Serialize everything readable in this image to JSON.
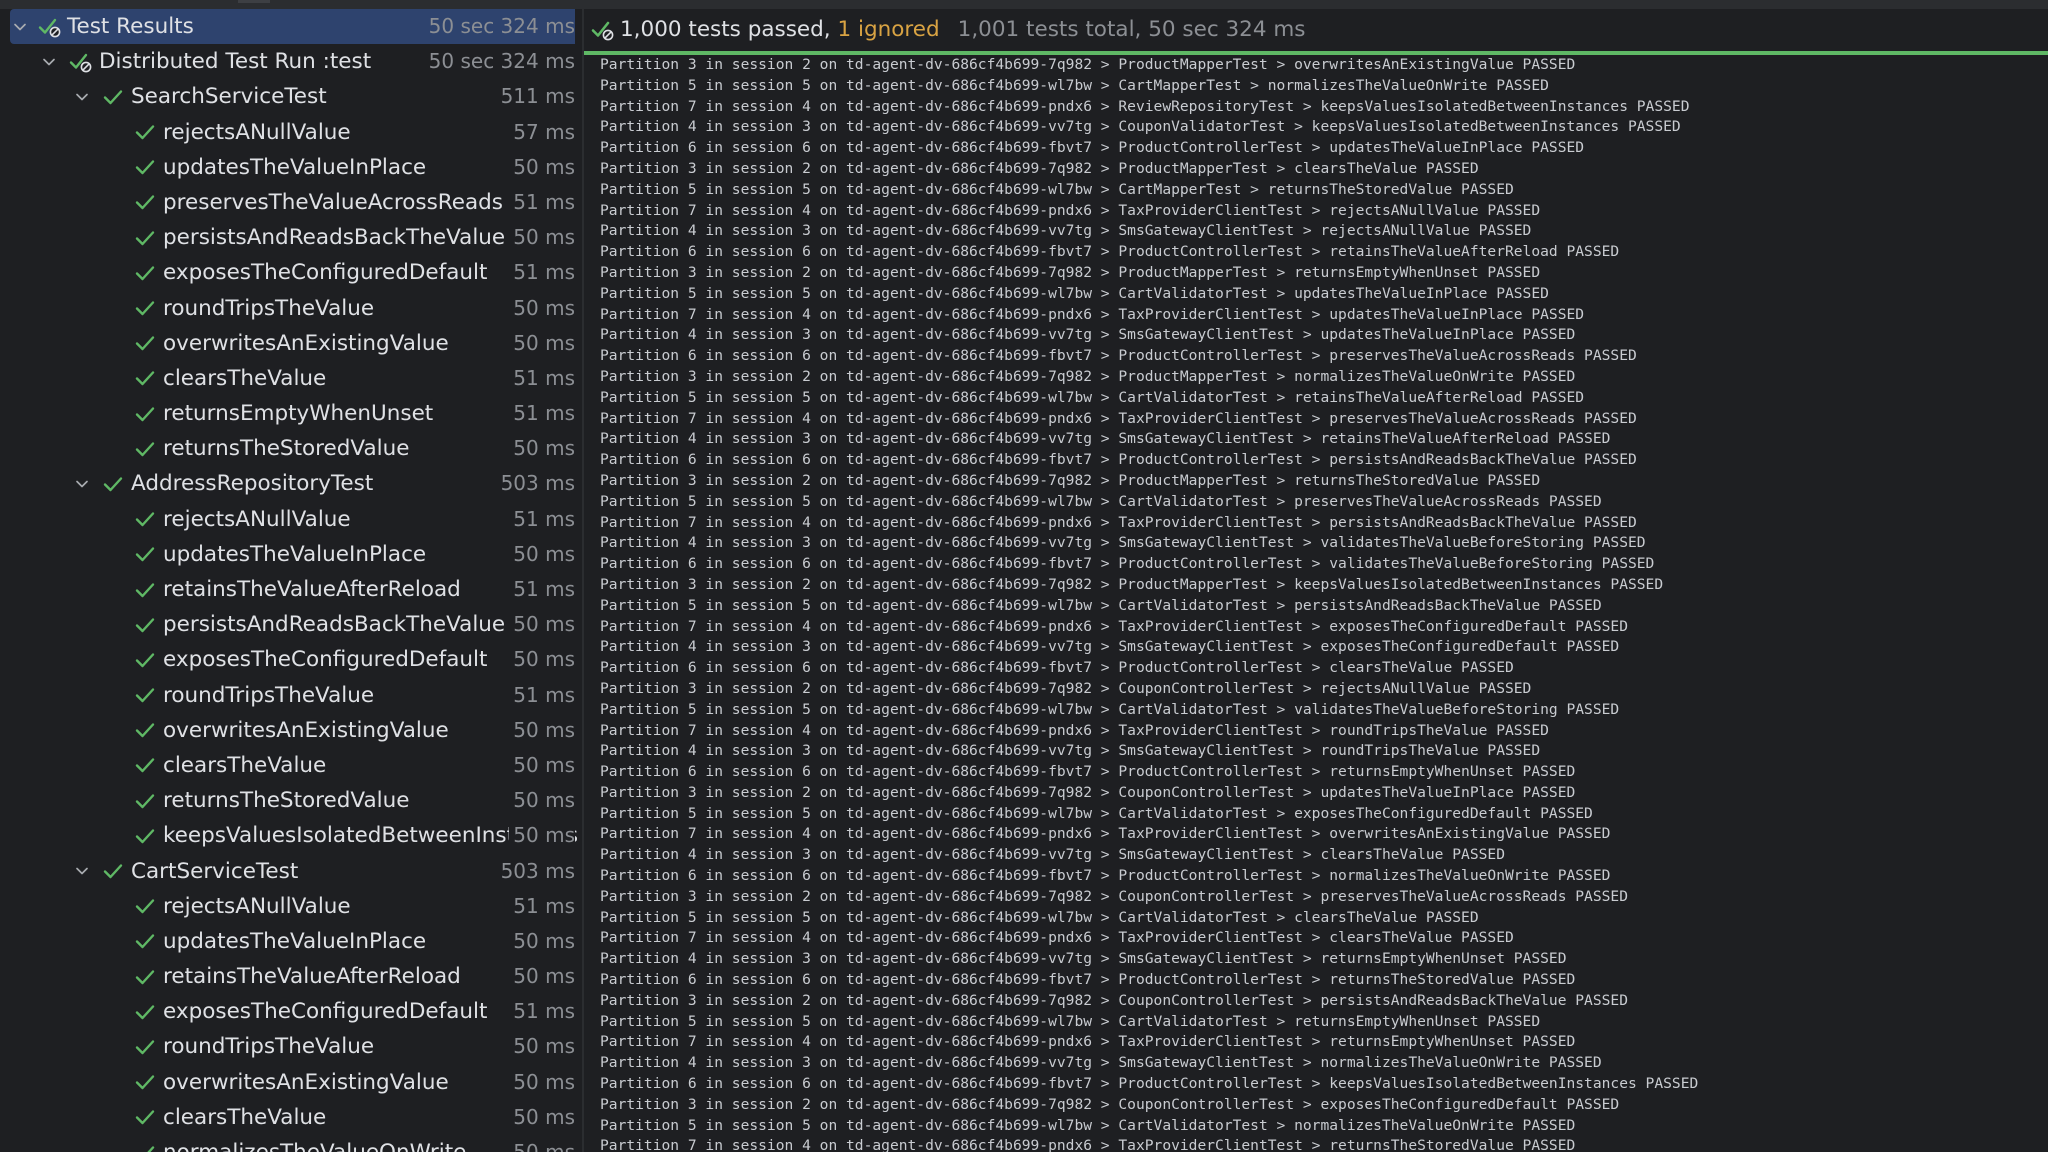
{
  "tree": {
    "rows": [
      {
        "depth": 0,
        "label": "Test Results",
        "duration": "50 sec 324 ms",
        "expanded": true,
        "status": "passed-ignored",
        "selected": true
      },
      {
        "depth": 1,
        "label": "Distributed Test Run :test",
        "duration": "50 sec 324 ms",
        "expanded": true,
        "status": "passed-ignored"
      },
      {
        "depth": 2,
        "label": "SearchServiceTest",
        "duration": "511 ms",
        "expanded": true,
        "status": "passed"
      },
      {
        "depth": 3,
        "label": "rejectsANullValue",
        "duration": "57 ms",
        "status": "passed"
      },
      {
        "depth": 3,
        "label": "updatesTheValueInPlace",
        "duration": "50 ms",
        "status": "passed"
      },
      {
        "depth": 3,
        "label": "preservesTheValueAcrossReads",
        "duration": "51 ms",
        "status": "passed"
      },
      {
        "depth": 3,
        "label": "persistsAndReadsBackTheValue",
        "duration": "50 ms",
        "status": "passed"
      },
      {
        "depth": 3,
        "label": "exposesTheConfiguredDefault",
        "duration": "51 ms",
        "status": "passed"
      },
      {
        "depth": 3,
        "label": "roundTripsTheValue",
        "duration": "50 ms",
        "status": "passed"
      },
      {
        "depth": 3,
        "label": "overwritesAnExistingValue",
        "duration": "50 ms",
        "status": "passed"
      },
      {
        "depth": 3,
        "label": "clearsTheValue",
        "duration": "51 ms",
        "status": "passed"
      },
      {
        "depth": 3,
        "label": "returnsEmptyWhenUnset",
        "duration": "51 ms",
        "status": "passed"
      },
      {
        "depth": 3,
        "label": "returnsTheStoredValue",
        "duration": "50 ms",
        "status": "passed"
      },
      {
        "depth": 2,
        "label": "AddressRepositoryTest",
        "duration": "503 ms",
        "expanded": true,
        "status": "passed"
      },
      {
        "depth": 3,
        "label": "rejectsANullValue",
        "duration": "51 ms",
        "status": "passed"
      },
      {
        "depth": 3,
        "label": "updatesTheValueInPlace",
        "duration": "50 ms",
        "status": "passed"
      },
      {
        "depth": 3,
        "label": "retainsTheValueAfterReload",
        "duration": "51 ms",
        "status": "passed"
      },
      {
        "depth": 3,
        "label": "persistsAndReadsBackTheValue",
        "duration": "50 ms",
        "status": "passed"
      },
      {
        "depth": 3,
        "label": "exposesTheConfiguredDefault",
        "duration": "50 ms",
        "status": "passed"
      },
      {
        "depth": 3,
        "label": "roundTripsTheValue",
        "duration": "51 ms",
        "status": "passed"
      },
      {
        "depth": 3,
        "label": "overwritesAnExistingValue",
        "duration": "50 ms",
        "status": "passed"
      },
      {
        "depth": 3,
        "label": "clearsTheValue",
        "duration": "50 ms",
        "status": "passed"
      },
      {
        "depth": 3,
        "label": "returnsTheStoredValue",
        "duration": "50 ms",
        "status": "passed"
      },
      {
        "depth": 3,
        "label": "keepsValuesIsolatedBetweenInstances",
        "duration": "50 ms",
        "status": "passed"
      },
      {
        "depth": 2,
        "label": "CartServiceTest",
        "duration": "503 ms",
        "expanded": true,
        "status": "passed"
      },
      {
        "depth": 3,
        "label": "rejectsANullValue",
        "duration": "51 ms",
        "status": "passed"
      },
      {
        "depth": 3,
        "label": "updatesTheValueInPlace",
        "duration": "50 ms",
        "status": "passed"
      },
      {
        "depth": 3,
        "label": "retainsTheValueAfterReload",
        "duration": "50 ms",
        "status": "passed"
      },
      {
        "depth": 3,
        "label": "exposesTheConfiguredDefault",
        "duration": "51 ms",
        "status": "passed"
      },
      {
        "depth": 3,
        "label": "roundTripsTheValue",
        "duration": "50 ms",
        "status": "passed"
      },
      {
        "depth": 3,
        "label": "overwritesAnExistingValue",
        "duration": "50 ms",
        "status": "passed"
      },
      {
        "depth": 3,
        "label": "clearsTheValue",
        "duration": "50 ms",
        "status": "passed"
      },
      {
        "depth": 3,
        "label": "normalizesTheValueOnWrite",
        "duration": "50 ms",
        "status": "passed"
      }
    ]
  },
  "summary": {
    "passed": "1,000 tests passed,",
    "ignored": "1 ignored",
    "total": "1,001 tests total, 50 sec 324 ms"
  },
  "console": {
    "lines": [
      "Partition 3 in session 2 on td-agent-dv-686cf4b699-7q982 > ProductMapperTest > overwritesAnExistingValue PASSED",
      "Partition 5 in session 5 on td-agent-dv-686cf4b699-wl7bw > CartMapperTest > normalizesTheValueOnWrite PASSED",
      "Partition 7 in session 4 on td-agent-dv-686cf4b699-pndx6 > ReviewRepositoryTest > keepsValuesIsolatedBetweenInstances PASSED",
      "Partition 4 in session 3 on td-agent-dv-686cf4b699-vv7tg > CouponValidatorTest > keepsValuesIsolatedBetweenInstances PASSED",
      "Partition 6 in session 6 on td-agent-dv-686cf4b699-fbvt7 > ProductControllerTest > updatesTheValueInPlace PASSED",
      "Partition 3 in session 2 on td-agent-dv-686cf4b699-7q982 > ProductMapperTest > clearsTheValue PASSED",
      "Partition 5 in session 5 on td-agent-dv-686cf4b699-wl7bw > CartMapperTest > returnsTheStoredValue PASSED",
      "Partition 7 in session 4 on td-agent-dv-686cf4b699-pndx6 > TaxProviderClientTest > rejectsANullValue PASSED",
      "Partition 4 in session 3 on td-agent-dv-686cf4b699-vv7tg > SmsGatewayClientTest > rejectsANullValue PASSED",
      "Partition 6 in session 6 on td-agent-dv-686cf4b699-fbvt7 > ProductControllerTest > retainsTheValueAfterReload PASSED",
      "Partition 3 in session 2 on td-agent-dv-686cf4b699-7q982 > ProductMapperTest > returnsEmptyWhenUnset PASSED",
      "Partition 5 in session 5 on td-agent-dv-686cf4b699-wl7bw > CartValidatorTest > updatesTheValueInPlace PASSED",
      "Partition 7 in session 4 on td-agent-dv-686cf4b699-pndx6 > TaxProviderClientTest > updatesTheValueInPlace PASSED",
      "Partition 4 in session 3 on td-agent-dv-686cf4b699-vv7tg > SmsGatewayClientTest > updatesTheValueInPlace PASSED",
      "Partition 6 in session 6 on td-agent-dv-686cf4b699-fbvt7 > ProductControllerTest > preservesTheValueAcrossReads PASSED",
      "Partition 3 in session 2 on td-agent-dv-686cf4b699-7q982 > ProductMapperTest > normalizesTheValueOnWrite PASSED",
      "Partition 5 in session 5 on td-agent-dv-686cf4b699-wl7bw > CartValidatorTest > retainsTheValueAfterReload PASSED",
      "Partition 7 in session 4 on td-agent-dv-686cf4b699-pndx6 > TaxProviderClientTest > preservesTheValueAcrossReads PASSED",
      "Partition 4 in session 3 on td-agent-dv-686cf4b699-vv7tg > SmsGatewayClientTest > retainsTheValueAfterReload PASSED",
      "Partition 6 in session 6 on td-agent-dv-686cf4b699-fbvt7 > ProductControllerTest > persistsAndReadsBackTheValue PASSED",
      "Partition 3 in session 2 on td-agent-dv-686cf4b699-7q982 > ProductMapperTest > returnsTheStoredValue PASSED",
      "Partition 5 in session 5 on td-agent-dv-686cf4b699-wl7bw > CartValidatorTest > preservesTheValueAcrossReads PASSED",
      "Partition 7 in session 4 on td-agent-dv-686cf4b699-pndx6 > TaxProviderClientTest > persistsAndReadsBackTheValue PASSED",
      "Partition 4 in session 3 on td-agent-dv-686cf4b699-vv7tg > SmsGatewayClientTest > validatesTheValueBeforeStoring PASSED",
      "Partition 6 in session 6 on td-agent-dv-686cf4b699-fbvt7 > ProductControllerTest > validatesTheValueBeforeStoring PASSED",
      "Partition 3 in session 2 on td-agent-dv-686cf4b699-7q982 > ProductMapperTest > keepsValuesIsolatedBetweenInstances PASSED",
      "Partition 5 in session 5 on td-agent-dv-686cf4b699-wl7bw > CartValidatorTest > persistsAndReadsBackTheValue PASSED",
      "Partition 7 in session 4 on td-agent-dv-686cf4b699-pndx6 > TaxProviderClientTest > exposesTheConfiguredDefault PASSED",
      "Partition 4 in session 3 on td-agent-dv-686cf4b699-vv7tg > SmsGatewayClientTest > exposesTheConfiguredDefault PASSED",
      "Partition 6 in session 6 on td-agent-dv-686cf4b699-fbvt7 > ProductControllerTest > clearsTheValue PASSED",
      "Partition 3 in session 2 on td-agent-dv-686cf4b699-7q982 > CouponControllerTest > rejectsANullValue PASSED",
      "Partition 5 in session 5 on td-agent-dv-686cf4b699-wl7bw > CartValidatorTest > validatesTheValueBeforeStoring PASSED",
      "Partition 7 in session 4 on td-agent-dv-686cf4b699-pndx6 > TaxProviderClientTest > roundTripsTheValue PASSED",
      "Partition 4 in session 3 on td-agent-dv-686cf4b699-vv7tg > SmsGatewayClientTest > roundTripsTheValue PASSED",
      "Partition 6 in session 6 on td-agent-dv-686cf4b699-fbvt7 > ProductControllerTest > returnsEmptyWhenUnset PASSED",
      "Partition 3 in session 2 on td-agent-dv-686cf4b699-7q982 > CouponControllerTest > updatesTheValueInPlace PASSED",
      "Partition 5 in session 5 on td-agent-dv-686cf4b699-wl7bw > CartValidatorTest > exposesTheConfiguredDefault PASSED",
      "Partition 7 in session 4 on td-agent-dv-686cf4b699-pndx6 > TaxProviderClientTest > overwritesAnExistingValue PASSED",
      "Partition 4 in session 3 on td-agent-dv-686cf4b699-vv7tg > SmsGatewayClientTest > clearsTheValue PASSED",
      "Partition 6 in session 6 on td-agent-dv-686cf4b699-fbvt7 > ProductControllerTest > normalizesTheValueOnWrite PASSED",
      "Partition 3 in session 2 on td-agent-dv-686cf4b699-7q982 > CouponControllerTest > preservesTheValueAcrossReads PASSED",
      "Partition 5 in session 5 on td-agent-dv-686cf4b699-wl7bw > CartValidatorTest > clearsTheValue PASSED",
      "Partition 7 in session 4 on td-agent-dv-686cf4b699-pndx6 > TaxProviderClientTest > clearsTheValue PASSED",
      "Partition 4 in session 3 on td-agent-dv-686cf4b699-vv7tg > SmsGatewayClientTest > returnsEmptyWhenUnset PASSED",
      "Partition 6 in session 6 on td-agent-dv-686cf4b699-fbvt7 > ProductControllerTest > returnsTheStoredValue PASSED",
      "Partition 3 in session 2 on td-agent-dv-686cf4b699-7q982 > CouponControllerTest > persistsAndReadsBackTheValue PASSED",
      "Partition 5 in session 5 on td-agent-dv-686cf4b699-wl7bw > CartValidatorTest > returnsEmptyWhenUnset PASSED",
      "Partition 7 in session 4 on td-agent-dv-686cf4b699-pndx6 > TaxProviderClientTest > returnsEmptyWhenUnset PASSED",
      "Partition 4 in session 3 on td-agent-dv-686cf4b699-vv7tg > SmsGatewayClientTest > normalizesTheValueOnWrite PASSED",
      "Partition 6 in session 6 on td-agent-dv-686cf4b699-fbvt7 > ProductControllerTest > keepsValuesIsolatedBetweenInstances PASSED",
      "Partition 3 in session 2 on td-agent-dv-686cf4b699-7q982 > CouponControllerTest > exposesTheConfiguredDefault PASSED",
      "Partition 5 in session 5 on td-agent-dv-686cf4b699-wl7bw > CartValidatorTest > normalizesTheValueOnWrite PASSED",
      "Partition 7 in session 4 on td-agent-dv-686cf4b699-pndx6 > TaxProviderClientTest > returnsTheStoredValue PASSED"
    ]
  },
  "colors": {
    "passed": "#5fb865",
    "ignored": "#d9a343",
    "selection": "#2e436e",
    "background": "#1e1f22"
  }
}
